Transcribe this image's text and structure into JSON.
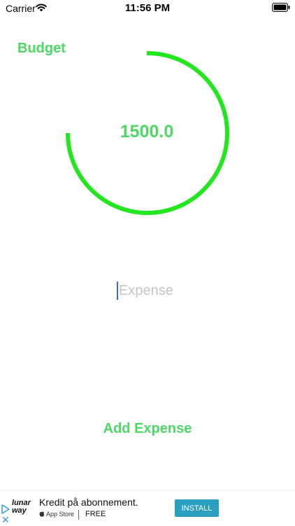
{
  "status_bar": {
    "carrier": "Carrier",
    "time": "11:56 PM",
    "wifi_icon": "wifi-icon",
    "battery_icon": "battery-icon"
  },
  "budget": {
    "title": "Budget",
    "amount": "1500.0",
    "ring_color": "#22e61e"
  },
  "expense_input": {
    "value": "",
    "placeholder": "Expense"
  },
  "add_expense": {
    "label": "Add Expense"
  },
  "ad": {
    "brand_logo_text": "lunar way",
    "title": "Kredit på abonnement.",
    "store": "App Store",
    "price": "FREE",
    "install_label": "INSTALL",
    "install_color": "#2b9fbf"
  },
  "colors": {
    "accent_green": "#4cd964",
    "placeholder_gray": "#c5c5c9"
  }
}
